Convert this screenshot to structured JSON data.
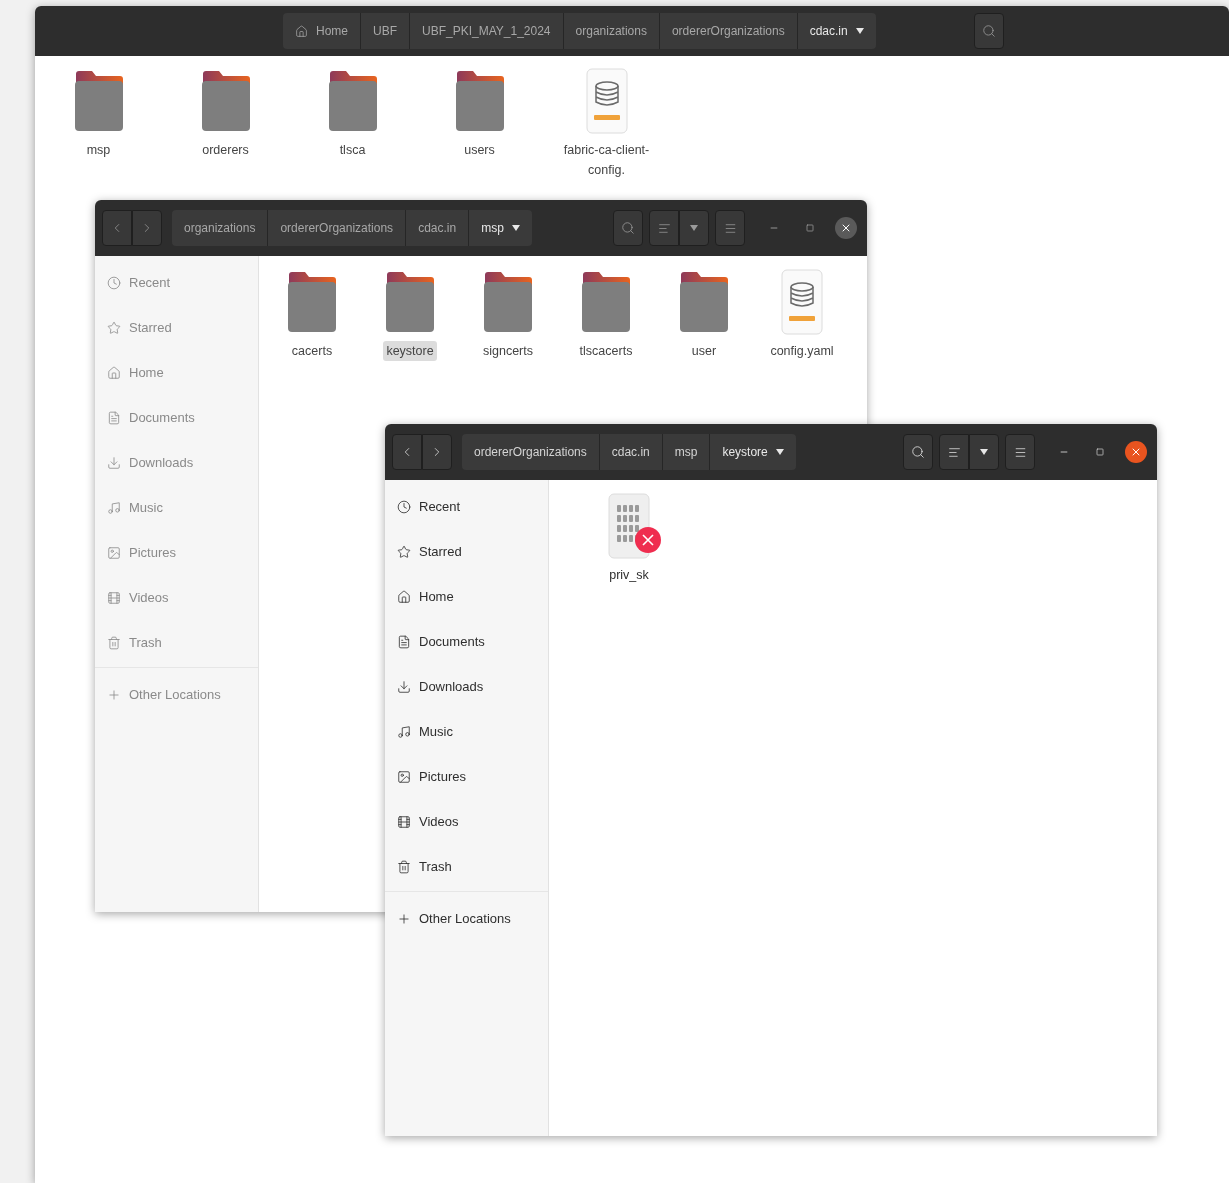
{
  "windows": [
    {
      "kind": "partial",
      "active": false,
      "path": [
        {
          "label": "Home",
          "kind": "home",
          "selected": false
        },
        {
          "label": "UBF",
          "kind": "folder",
          "selected": false
        },
        {
          "label": "UBF_PKI_MAY_1_2024",
          "kind": "folder",
          "selected": false
        },
        {
          "label": "organizations",
          "kind": "folder",
          "selected": false
        },
        {
          "label": "ordererOrganizations",
          "kind": "folder",
          "selected": false
        },
        {
          "label": "cdac.in",
          "kind": "folder",
          "selected": true
        }
      ],
      "files": [
        {
          "name": "msp",
          "kind": "folder",
          "selected": false,
          "unreadable": false
        },
        {
          "name": "orderers",
          "kind": "folder",
          "selected": false,
          "unreadable": false
        },
        {
          "name": "tlsca",
          "kind": "folder",
          "selected": false,
          "unreadable": false
        },
        {
          "name": "users",
          "kind": "folder",
          "selected": false,
          "unreadable": false
        },
        {
          "name": "fabric-ca-client-config.",
          "kind": "yaml",
          "selected": false,
          "unreadable": false
        }
      ]
    },
    {
      "kind": "full",
      "active": false,
      "path": [
        {
          "label": "organizations",
          "kind": "folder",
          "selected": false
        },
        {
          "label": "ordererOrganizations",
          "kind": "folder",
          "selected": false
        },
        {
          "label": "cdac.in",
          "kind": "folder",
          "selected": false
        },
        {
          "label": "msp",
          "kind": "folder",
          "selected": true
        }
      ],
      "sidebar": {
        "items": [
          "Recent",
          "Starred",
          "Home",
          "Documents",
          "Downloads",
          "Music",
          "Pictures",
          "Videos",
          "Trash"
        ],
        "other_locations": "Other Locations"
      },
      "files": [
        {
          "name": "cacerts",
          "kind": "folder",
          "selected": false,
          "unreadable": false
        },
        {
          "name": "keystore",
          "kind": "folder",
          "selected": true,
          "unreadable": false
        },
        {
          "name": "signcerts",
          "kind": "folder",
          "selected": false,
          "unreadable": false
        },
        {
          "name": "tlscacerts",
          "kind": "folder",
          "selected": false,
          "unreadable": false
        },
        {
          "name": "user",
          "kind": "folder",
          "selected": false,
          "unreadable": false
        },
        {
          "name": "config.yaml",
          "kind": "yaml",
          "selected": false,
          "unreadable": false
        }
      ]
    },
    {
      "kind": "full",
      "active": true,
      "path": [
        {
          "label": "ordererOrganizations",
          "kind": "folder",
          "selected": false
        },
        {
          "label": "cdac.in",
          "kind": "folder",
          "selected": false
        },
        {
          "label": "msp",
          "kind": "folder",
          "selected": false
        },
        {
          "label": "keystore",
          "kind": "folder",
          "selected": true
        }
      ],
      "sidebar": {
        "items": [
          "Recent",
          "Starred",
          "Home",
          "Documents",
          "Downloads",
          "Music",
          "Pictures",
          "Videos",
          "Trash"
        ],
        "other_locations": "Other Locations"
      },
      "files": [
        {
          "name": "priv_sk",
          "kind": "binary",
          "selected": false,
          "unreadable": true
        }
      ]
    }
  ]
}
